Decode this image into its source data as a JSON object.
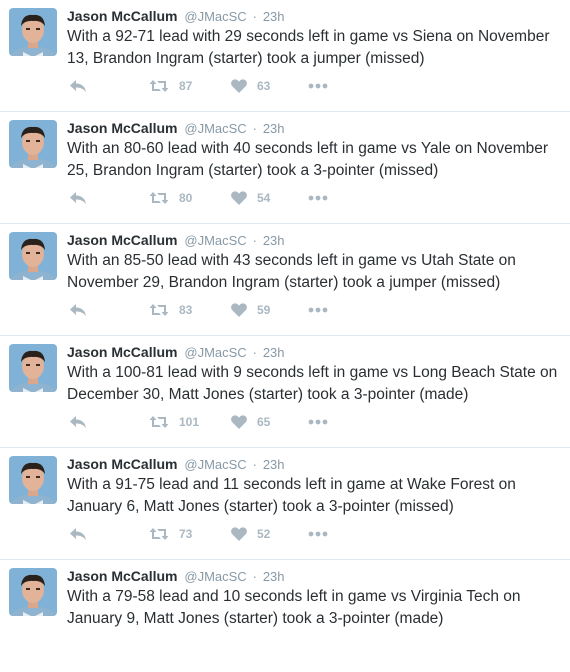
{
  "tweets": [
    {
      "name": "Jason McCallum",
      "handle": "@JMacSC",
      "sep": "·",
      "time": "23h",
      "text": "With a 92-71 lead with 29 seconds left in game vs Siena on November 13, Brandon Ingram (starter) took a jumper (missed)",
      "retweets": "87",
      "likes": "63"
    },
    {
      "name": "Jason McCallum",
      "handle": "@JMacSC",
      "sep": "·",
      "time": "23h",
      "text": "With an 80-60 lead with 40 seconds left in game vs Yale on November 25, Brandon Ingram (starter) took a 3-pointer (missed)",
      "retweets": "80",
      "likes": "54"
    },
    {
      "name": "Jason McCallum",
      "handle": "@JMacSC",
      "sep": "·",
      "time": "23h",
      "text": "With an 85-50 lead with 43 seconds left in game vs Utah State on November 29, Brandon Ingram (starter) took a jumper (missed)",
      "retweets": "83",
      "likes": "59"
    },
    {
      "name": "Jason McCallum",
      "handle": "@JMacSC",
      "sep": "·",
      "time": "23h",
      "text": "With a 100-81 lead with 9 seconds left in game vs Long Beach State on December 30, Matt Jones (starter) took a 3-pointer (made)",
      "retweets": "101",
      "likes": "65"
    },
    {
      "name": "Jason McCallum",
      "handle": "@JMacSC",
      "sep": "·",
      "time": "23h",
      "text": "With a 91-75 lead and 11 seconds left in game at Wake Forest on January 6, Matt Jones (starter) took a 3-pointer (missed)",
      "retweets": "73",
      "likes": "52"
    },
    {
      "name": "Jason McCallum",
      "handle": "@JMacSC",
      "sep": "·",
      "time": "23h",
      "text": "With a 79-58 lead and 10 seconds left in game vs Virginia Tech on January 9, Matt Jones (starter) took a 3-pointer (made)",
      "retweets": "",
      "likes": ""
    }
  ],
  "icons": {
    "reply": "reply-icon",
    "retweet": "retweet-icon",
    "like": "heart-icon",
    "more": "more-icon"
  },
  "colors": {
    "icon": "#aab8c2",
    "text": "#292f33",
    "meta": "#8899a6",
    "avatar_bg": "#7fb2d6"
  }
}
